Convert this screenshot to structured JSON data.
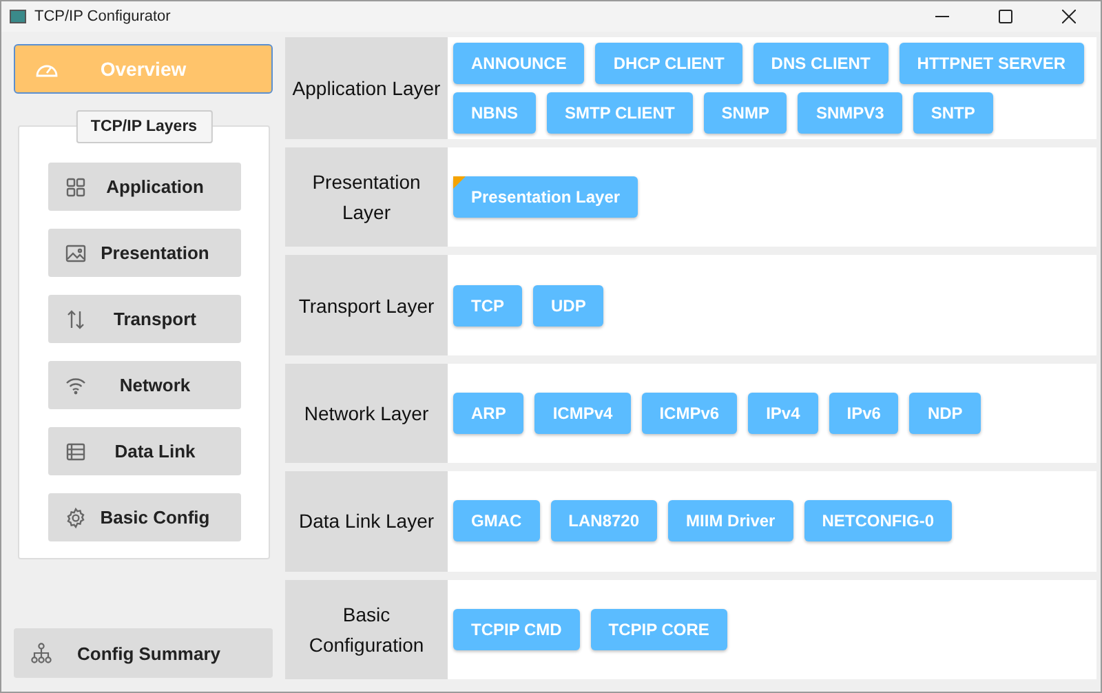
{
  "window": {
    "title": "TCP/IP Configurator"
  },
  "sidebar": {
    "overview": {
      "label": "Overview",
      "selected": true
    },
    "layers_panel": {
      "title": "TCP/IP Layers",
      "items": [
        {
          "label": "Application"
        },
        {
          "label": "Presentation"
        },
        {
          "label": "Transport"
        },
        {
          "label": "Network"
        },
        {
          "label": "Data Link"
        },
        {
          "label": "Basic Config"
        }
      ]
    },
    "summary": {
      "label": "Config Summary"
    }
  },
  "layers": [
    {
      "name": "Application Layer",
      "modules": [
        {
          "label": "ANNOUNCE",
          "flagged": false
        },
        {
          "label": "DHCP CLIENT",
          "flagged": false
        },
        {
          "label": "DNS CLIENT",
          "flagged": false
        },
        {
          "label": "HTTPNET SERVER",
          "flagged": false
        },
        {
          "label": "NBNS",
          "flagged": false
        },
        {
          "label": "SMTP CLIENT",
          "flagged": false
        },
        {
          "label": "SNMP",
          "flagged": false
        },
        {
          "label": "SNMPV3",
          "flagged": false
        },
        {
          "label": "SNTP",
          "flagged": false
        }
      ]
    },
    {
      "name": "Presentation Layer",
      "modules": [
        {
          "label": "Presentation Layer",
          "flagged": true
        }
      ]
    },
    {
      "name": "Transport Layer",
      "modules": [
        {
          "label": "TCP",
          "flagged": false
        },
        {
          "label": "UDP",
          "flagged": false
        }
      ]
    },
    {
      "name": "Network Layer",
      "modules": [
        {
          "label": "ARP",
          "flagged": false
        },
        {
          "label": "ICMPv4",
          "flagged": false
        },
        {
          "label": "ICMPv6",
          "flagged": false
        },
        {
          "label": "IPv4",
          "flagged": false
        },
        {
          "label": "IPv6",
          "flagged": false
        },
        {
          "label": "NDP",
          "flagged": false
        }
      ]
    },
    {
      "name": "Data Link Layer",
      "modules": [
        {
          "label": "GMAC",
          "flagged": false
        },
        {
          "label": "LAN8720",
          "flagged": false
        },
        {
          "label": "MIIM Driver",
          "flagged": false
        },
        {
          "label": "NETCONFIG-0",
          "flagged": false
        }
      ]
    },
    {
      "name": "Basic Configuration",
      "modules": [
        {
          "label": "TCPIP CMD",
          "flagged": false
        },
        {
          "label": "TCPIP CORE",
          "flagged": false
        }
      ]
    }
  ]
}
